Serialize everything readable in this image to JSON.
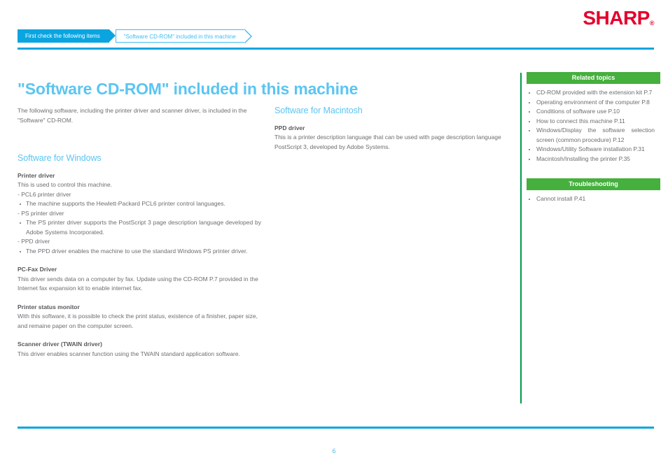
{
  "brand": {
    "logo_text": "SHARP",
    "registered_mark": "®"
  },
  "breadcrumb": {
    "items": [
      {
        "label": "First check the following items",
        "state": "active"
      },
      {
        "label": "\"Software CD-ROM\" included in this machine",
        "state": "current"
      }
    ]
  },
  "page": {
    "title": "\"Software CD-ROM\" included in this machine",
    "number": "6"
  },
  "colors": {
    "accent_blue": "#0aa5e0",
    "title_blue": "#5bc5f2",
    "brand_red": "#e4002b",
    "sidebar_green": "#45b03d",
    "rail_green": "#00994d",
    "body_gray": "#6d6e71"
  },
  "content": {
    "intro": "The following software, including the printer driver and scanner driver, is included in the \"Software\" CD-ROM.",
    "windows": {
      "heading": "Software for Windows",
      "printer_driver": {
        "title": "Printer driver",
        "desc": "This is used to control this machine.",
        "pcl6_label": "- PCL6 printer driver",
        "pcl6_bullet": "The machine supports the Hewlett-Packard PCL6 printer control languages.",
        "ps_label": "- PS printer driver",
        "ps_bullet": "The PS printer driver supports the PostScript 3 page description language developed by Adobe Systems Incorporated.",
        "ppd_label": "- PPD driver",
        "ppd_bullet": "The PPD driver enables the machine to use the standard Windows PS printer driver."
      },
      "pcfax": {
        "title": "PC-Fax Driver",
        "desc": "This driver sends data on a computer by fax. Update using the CD-ROM P.7 provided in the Internet fax expansion kit to enable internet fax."
      },
      "status_monitor": {
        "title": "Printer status monitor",
        "desc": "With this software, it is possible to check the print status, existence of a finisher, paper size, and remaine paper on the computer screen."
      },
      "scanner": {
        "title": "Scanner driver (TWAIN driver)",
        "desc": "This driver enables scanner function using the TWAIN standard application software."
      }
    },
    "macintosh": {
      "heading": "Software for Macintosh",
      "ppd": {
        "title": "PPD driver",
        "desc": "This is a printer description language that can be used with page description language PostScript 3, developed by Adobe Systems."
      }
    }
  },
  "sidebar": {
    "related_topics": {
      "heading": "Related topics",
      "items": [
        "CD-ROM provided with the extension kit P.7",
        "Operating environment of the computer P.8",
        "Conditions of software use P.10",
        "How to connect this machine P.11",
        "Windows/Display the software selection screen (common procedure) P.12",
        "Windows/Utility Software installation P.31",
        "Macintosh/Installing the printer P.35"
      ]
    },
    "troubleshooting": {
      "heading": "Troubleshooting",
      "items": [
        "Cannot install P.41"
      ]
    }
  }
}
